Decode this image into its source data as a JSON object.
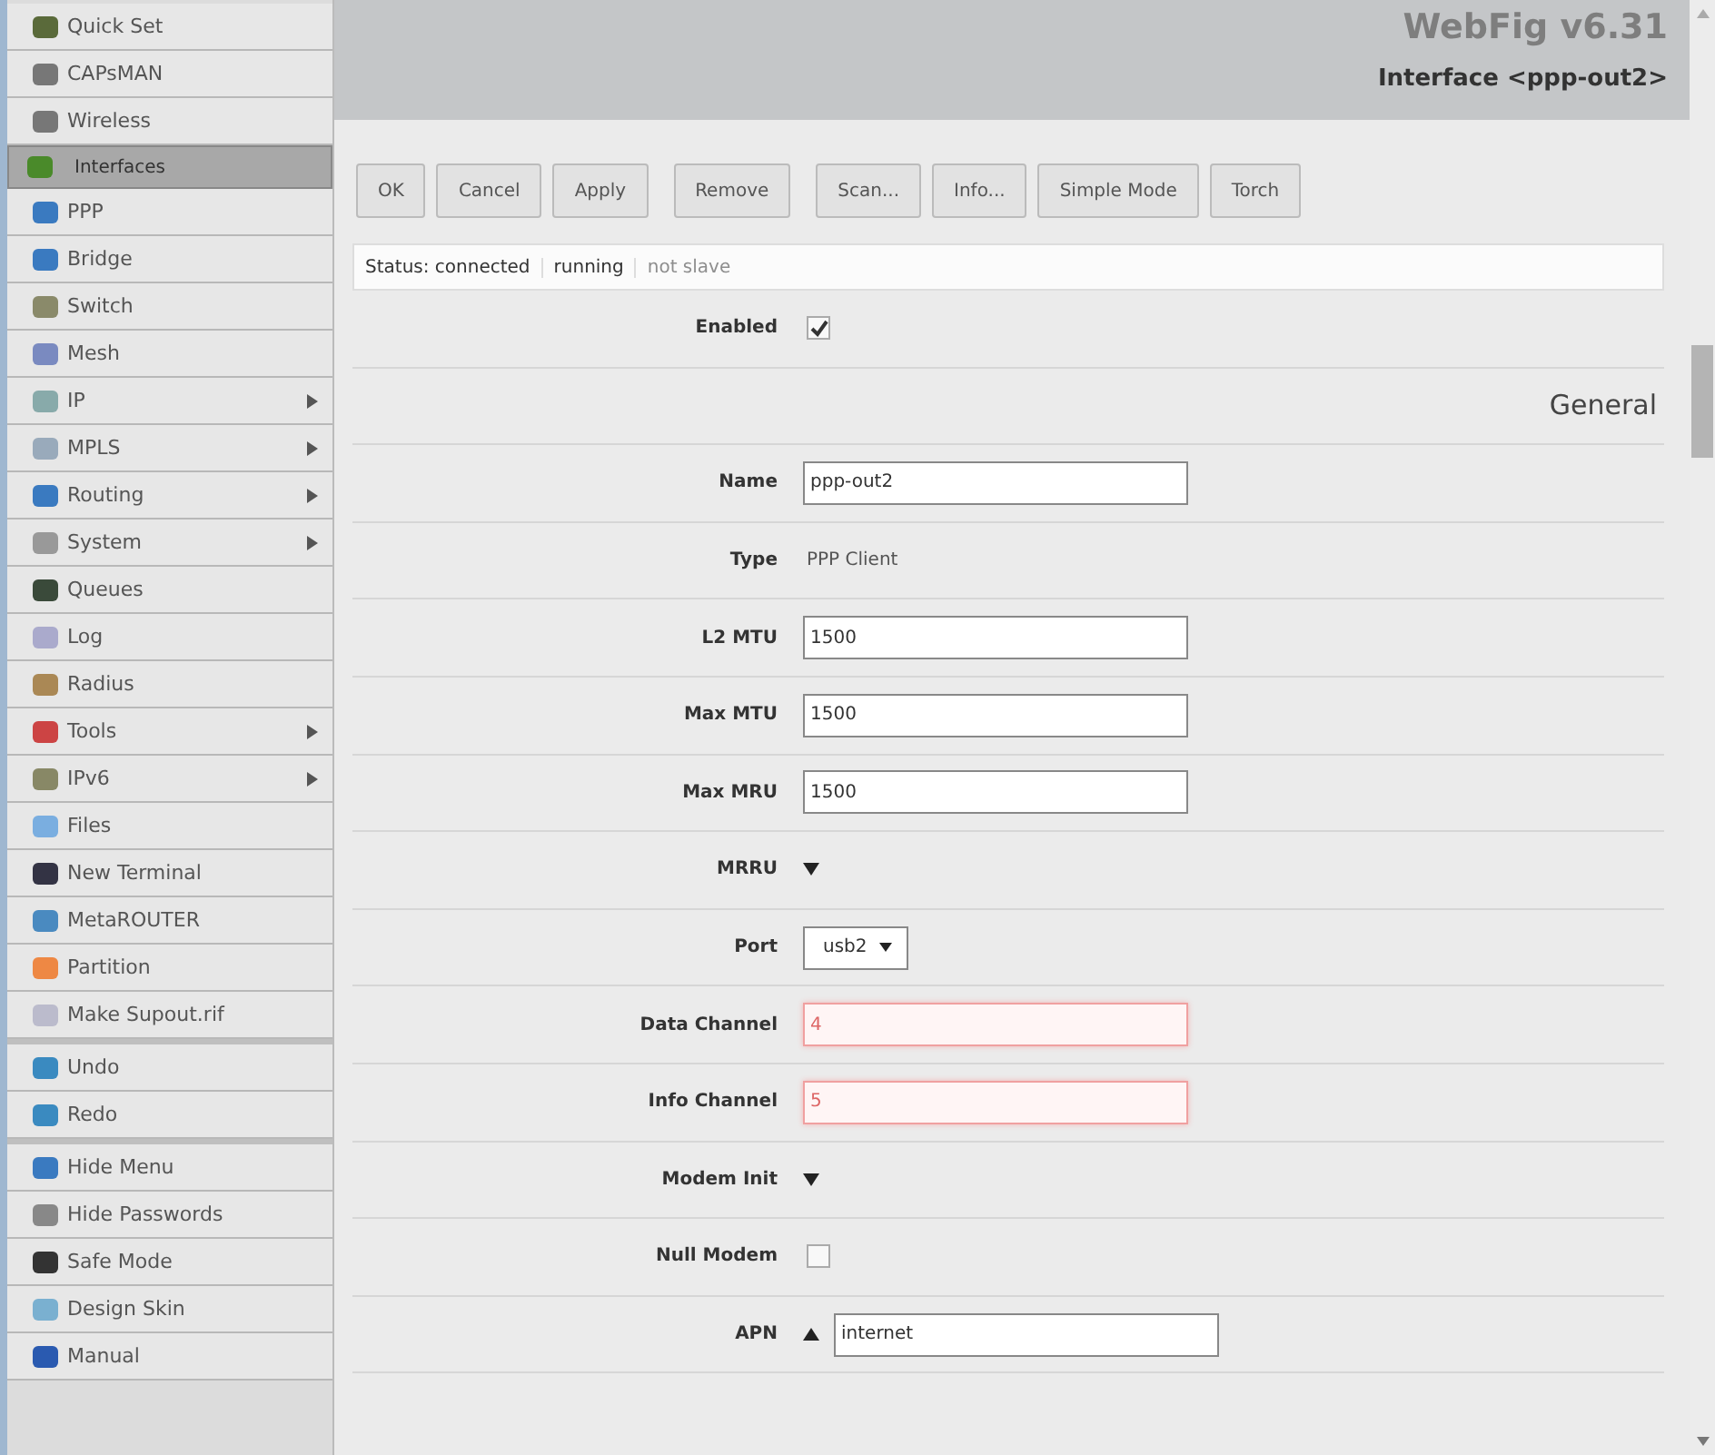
{
  "sidebar": {
    "groups": [
      {
        "items": [
          {
            "label": "Quick Set",
            "selected": false,
            "has_submenu": false
          },
          {
            "label": "CAPsMAN",
            "selected": false,
            "has_submenu": false
          },
          {
            "label": "Wireless",
            "selected": false,
            "has_submenu": false
          },
          {
            "label": "Interfaces",
            "selected": true,
            "has_submenu": false
          },
          {
            "label": "PPP",
            "selected": false,
            "has_submenu": false
          },
          {
            "label": "Bridge",
            "selected": false,
            "has_submenu": false
          },
          {
            "label": "Switch",
            "selected": false,
            "has_submenu": false
          },
          {
            "label": "Mesh",
            "selected": false,
            "has_submenu": false
          },
          {
            "label": "IP",
            "selected": false,
            "has_submenu": true
          },
          {
            "label": "MPLS",
            "selected": false,
            "has_submenu": true
          },
          {
            "label": "Routing",
            "selected": false,
            "has_submenu": true
          },
          {
            "label": "System",
            "selected": false,
            "has_submenu": true
          },
          {
            "label": "Queues",
            "selected": false,
            "has_submenu": false
          },
          {
            "label": "Log",
            "selected": false,
            "has_submenu": false
          },
          {
            "label": "Radius",
            "selected": false,
            "has_submenu": false
          },
          {
            "label": "Tools",
            "selected": false,
            "has_submenu": true
          },
          {
            "label": "IPv6",
            "selected": false,
            "has_submenu": true
          },
          {
            "label": "Files",
            "selected": false,
            "has_submenu": false
          },
          {
            "label": "New Terminal",
            "selected": false,
            "has_submenu": false
          },
          {
            "label": "MetaROUTER",
            "selected": false,
            "has_submenu": false
          },
          {
            "label": "Partition",
            "selected": false,
            "has_submenu": false
          },
          {
            "label": "Make Supout.rif",
            "selected": false,
            "has_submenu": false
          }
        ]
      },
      {
        "items": [
          {
            "label": "Undo",
            "selected": false,
            "has_submenu": false
          },
          {
            "label": "Redo",
            "selected": false,
            "has_submenu": false
          }
        ]
      },
      {
        "items": [
          {
            "label": "Hide Menu",
            "selected": false,
            "has_submenu": false
          },
          {
            "label": "Hide Passwords",
            "selected": false,
            "has_submenu": false
          },
          {
            "label": "Safe Mode",
            "selected": false,
            "has_submenu": false
          },
          {
            "label": "Design Skin",
            "selected": false,
            "has_submenu": false
          },
          {
            "label": "Manual",
            "selected": false,
            "has_submenu": false
          }
        ]
      }
    ]
  },
  "header": {
    "brand": "WebFig v6.31",
    "title": "Interface <ppp-out2>"
  },
  "toolbar": {
    "groups": [
      [
        "OK",
        "Cancel",
        "Apply"
      ],
      [
        "Remove"
      ],
      [
        "Scan...",
        "Info...",
        "Simple Mode",
        "Torch"
      ]
    ]
  },
  "status": [
    {
      "text": "Status: connected",
      "disabled": false
    },
    {
      "text": "running",
      "disabled": false
    },
    {
      "text": "not slave",
      "disabled": true
    }
  ],
  "form": [
    {
      "kind": "checkbox",
      "label": "Enabled",
      "checked": true
    },
    {
      "kind": "section",
      "label": "General"
    },
    {
      "kind": "input",
      "label": "Name",
      "value": "ppp-out2",
      "invalid": false
    },
    {
      "kind": "text",
      "label": "Type",
      "value": "PPP Client"
    },
    {
      "kind": "input",
      "label": "L2 MTU",
      "value": "1500",
      "invalid": false
    },
    {
      "kind": "input",
      "label": "Max MTU",
      "value": "1500",
      "invalid": false
    },
    {
      "kind": "input",
      "label": "Max MRU",
      "value": "1500",
      "invalid": false
    },
    {
      "kind": "expander",
      "label": "MRRU",
      "expanded": false
    },
    {
      "kind": "select",
      "label": "Port",
      "value": "usb2"
    },
    {
      "kind": "input",
      "label": "Data Channel",
      "value": "4",
      "invalid": true
    },
    {
      "kind": "input",
      "label": "Info Channel",
      "value": "5",
      "invalid": true
    },
    {
      "kind": "expander",
      "label": "Modem Init",
      "expanded": false
    },
    {
      "kind": "checkbox",
      "label": "Null Modem",
      "checked": false
    },
    {
      "kind": "input",
      "label": "APN",
      "value": "internet",
      "invalid": false,
      "expanded": true
    }
  ]
}
